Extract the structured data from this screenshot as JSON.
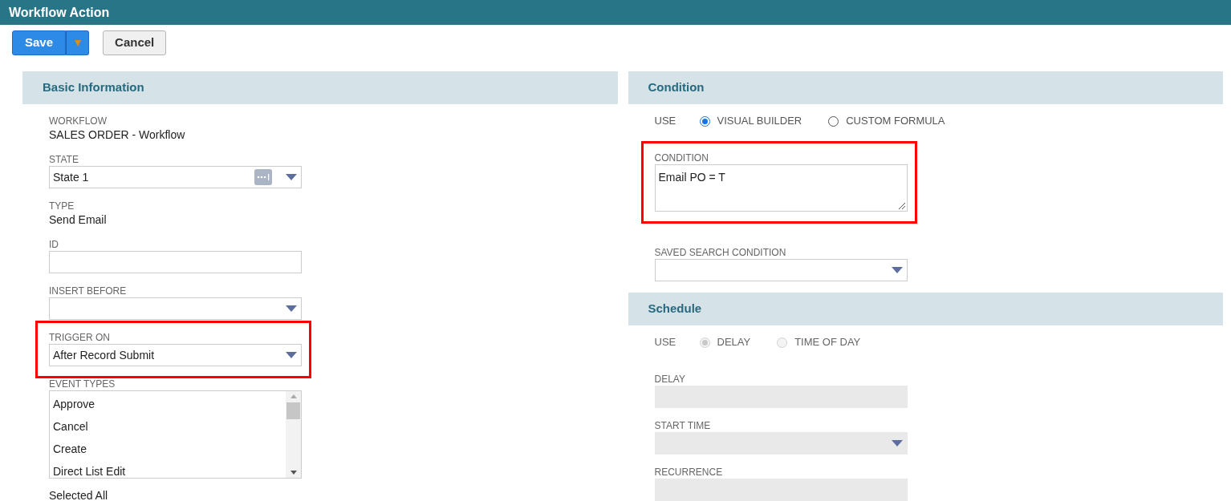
{
  "window": {
    "title": "Workflow Action"
  },
  "buttons": [
    {
      "label": "Save",
      "kind": "primary",
      "has_menu": true
    },
    {
      "label": "Cancel",
      "kind": "secondary",
      "has_menu": false
    }
  ],
  "left_panel": [
    {
      "title": "Basic Information",
      "fields": [
        {
          "kind": "static",
          "label": "WORKFLOW",
          "value": "SALES ORDER - Workflow"
        },
        {
          "kind": "select",
          "label": "STATE",
          "value": "State 1",
          "more_button": true
        },
        {
          "kind": "static",
          "label": "TYPE",
          "value": "Send Email"
        },
        {
          "kind": "text",
          "label": "ID"
        },
        {
          "kind": "select",
          "label": "INSERT BEFORE",
          "more_button": false
        },
        {
          "kind": "select",
          "label": "TRIGGER ON",
          "value": "After Record Submit",
          "more_button": false,
          "highlighted": true
        },
        {
          "kind": "multiselect",
          "label": "EVENT TYPES",
          "options": [
            "Approve",
            "Cancel",
            "Create",
            "Direct List Edit"
          ],
          "note": "Selected All"
        }
      ]
    }
  ],
  "right_panel": [
    {
      "title": "Condition",
      "fields": [
        {
          "kind": "radio",
          "label": "USE",
          "options": [
            {
              "label": "VISUAL BUILDER",
              "selected": true
            },
            {
              "label": "CUSTOM FORMULA",
              "selected": false
            }
          ]
        },
        {
          "kind": "textarea",
          "label": "CONDITION",
          "value": "Email PO = T",
          "highlighted": true
        },
        {
          "kind": "select",
          "label": "SAVED SEARCH CONDITION",
          "more_button": false
        }
      ]
    },
    {
      "title": "Schedule",
      "fields": [
        {
          "kind": "radio",
          "label": "USE",
          "options": [
            {
              "label": "DELAY",
              "selected": true
            },
            {
              "label": "TIME OF DAY",
              "selected": false
            }
          ],
          "disabled": true
        },
        {
          "kind": "text",
          "label": "DELAY",
          "disabled": true
        },
        {
          "kind": "select",
          "label": "START TIME",
          "more_button": false,
          "disabled": true
        },
        {
          "kind": "text",
          "label": "RECURRENCE",
          "disabled": true
        }
      ]
    }
  ]
}
